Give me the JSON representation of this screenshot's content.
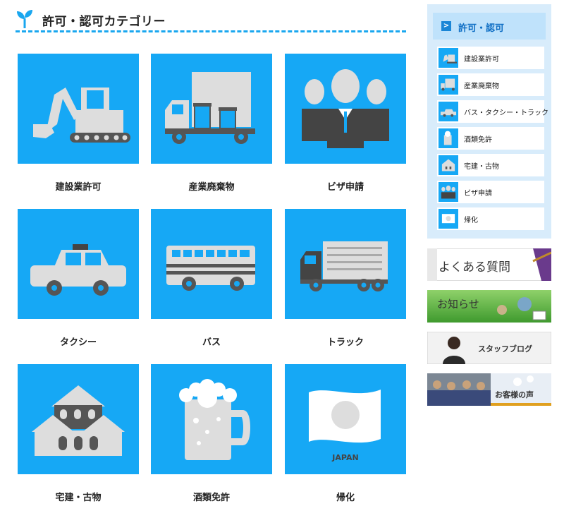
{
  "category": {
    "title": "許可・認可カテゴリー"
  },
  "tiles": [
    {
      "label": "建設業許可"
    },
    {
      "label": "産業廃棄物"
    },
    {
      "label": "ビザ申請"
    },
    {
      "label": "タクシー"
    },
    {
      "label": "バス"
    },
    {
      "label": "トラック"
    },
    {
      "label": "宅建・古物"
    },
    {
      "label": "酒類免許"
    },
    {
      "label": "帰化"
    }
  ],
  "flag_text": "JAPAN",
  "sidebar": {
    "title": "許可・認可",
    "items": [
      {
        "label": "建設業許可"
      },
      {
        "label": "産業廃棄物"
      },
      {
        "label": "バス・タクシー・トラック"
      },
      {
        "label": "酒類免許"
      },
      {
        "label": "宅建・古物"
      },
      {
        "label": "ビザ申請"
      },
      {
        "label": "帰化"
      }
    ]
  },
  "banners": {
    "faq": "よくある質問",
    "news": "お知らせ",
    "staff": "スタッフブログ",
    "voice": "お客様の声"
  },
  "colors": {
    "tile_blue": "#16a8f5",
    "accent": "#1aa7ef"
  }
}
